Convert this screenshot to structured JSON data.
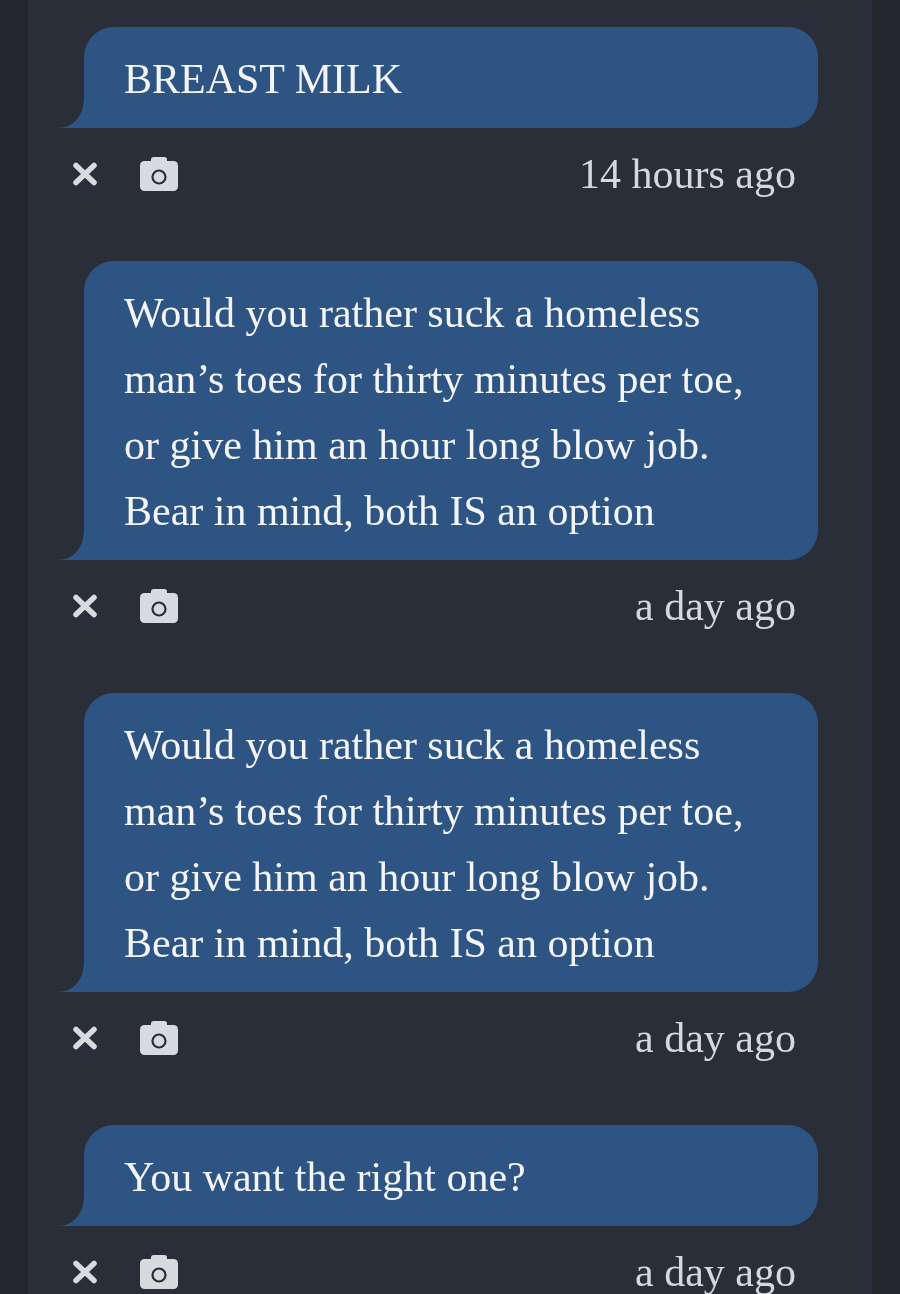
{
  "messages": [
    {
      "text": "BREAST MILK",
      "time": "14 hours ago"
    },
    {
      "text": "Would you rather suck a homeless man’s toes for thirty minutes per toe, or give him an hour long blow job. Bear in mind, both IS an option",
      "time": "a day ago"
    },
    {
      "text": "Would you rather suck a homeless man’s toes for thirty minutes per toe, or give him an hour long blow job. Bear in mind, both IS an option",
      "time": "a day ago"
    },
    {
      "text": "You want the right one?",
      "time": "a day ago"
    }
  ]
}
